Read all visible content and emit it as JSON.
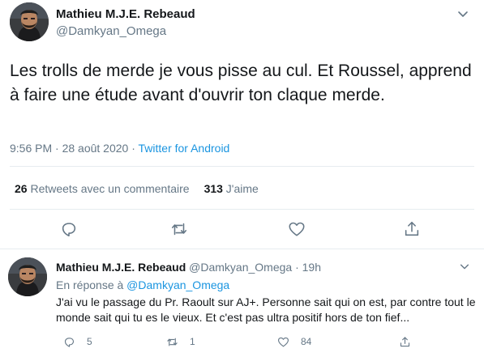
{
  "main_tweet": {
    "author_name": "Mathieu M.J.E. Rebeaud",
    "author_handle": "@Damkyan_Omega",
    "text": "Les trolls de merde je vous pisse au cul. Et Roussel, apprend à faire une étude avant d'ouvrir ton claque merde.",
    "time": "9:56 PM · 28 août 2020 · ",
    "source": "Twitter for Android",
    "retweets_count": "26",
    "retweets_label": " Retweets avec un commentaire",
    "likes_count": "313",
    "likes_label": " J'aime"
  },
  "reply_tweet": {
    "author_name": "Mathieu M.J.E. Rebeaud",
    "author_handle": "@Damkyan_Omega",
    "time": "19h",
    "in_reply_prefix": "En réponse à ",
    "in_reply_mention": "@Damkyan_Omega",
    "text": "J'ai vu le passage du Pr. Raoult sur AJ+. Personne sait qui on est, par contre tout le monde sait qui tu es le vieux. Et c'est pas ultra positif hors de ton fief...",
    "reply_count": "5",
    "retweet_count": "1",
    "like_count": "84"
  },
  "icons": {
    "caret": "chevron-down-icon",
    "reply": "comment-icon",
    "retweet": "retweet-icon",
    "like": "heart-icon",
    "share": "share-icon"
  },
  "colors": {
    "text": "#14171a",
    "secondary": "#657786",
    "link": "#1b95e0",
    "divider": "#e6ecf0"
  }
}
